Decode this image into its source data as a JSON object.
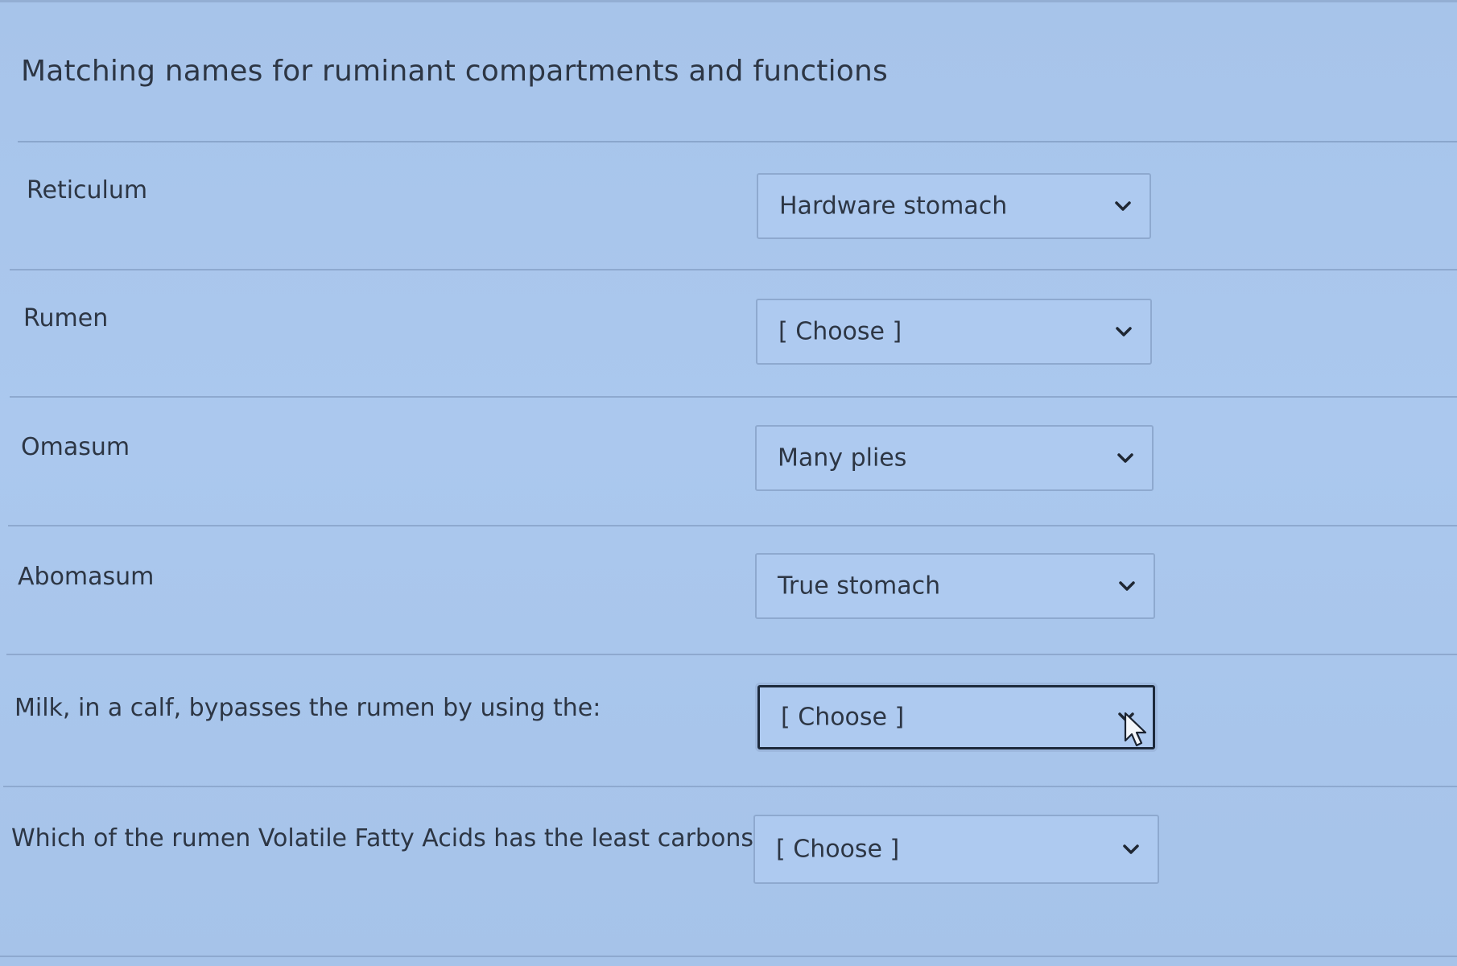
{
  "quiz": {
    "title": "Matching names for ruminant compartments and functions",
    "rows": [
      {
        "prompt": "Reticulum",
        "selected": "Hardware stomach"
      },
      {
        "prompt": "Rumen",
        "selected": "[ Choose ]"
      },
      {
        "prompt": "Omasum",
        "selected": "Many plies"
      },
      {
        "prompt": "Abomasum",
        "selected": "True stomach"
      },
      {
        "prompt": "Milk, in a calf, bypasses the rumen by using the:",
        "selected": "[ Choose ]"
      },
      {
        "prompt": "Which of the rumen Volatile Fatty Acids has the least carbons",
        "selected": "[ Choose ]"
      }
    ]
  },
  "icons": {
    "dropdown": "chevron-down-icon",
    "pointer": "mouse-pointer-icon"
  },
  "colors": {
    "page_background": "#a9c6ec",
    "text": "#2d3644",
    "border": "#8ea9cf",
    "focus_border": "#1d2a3c"
  }
}
